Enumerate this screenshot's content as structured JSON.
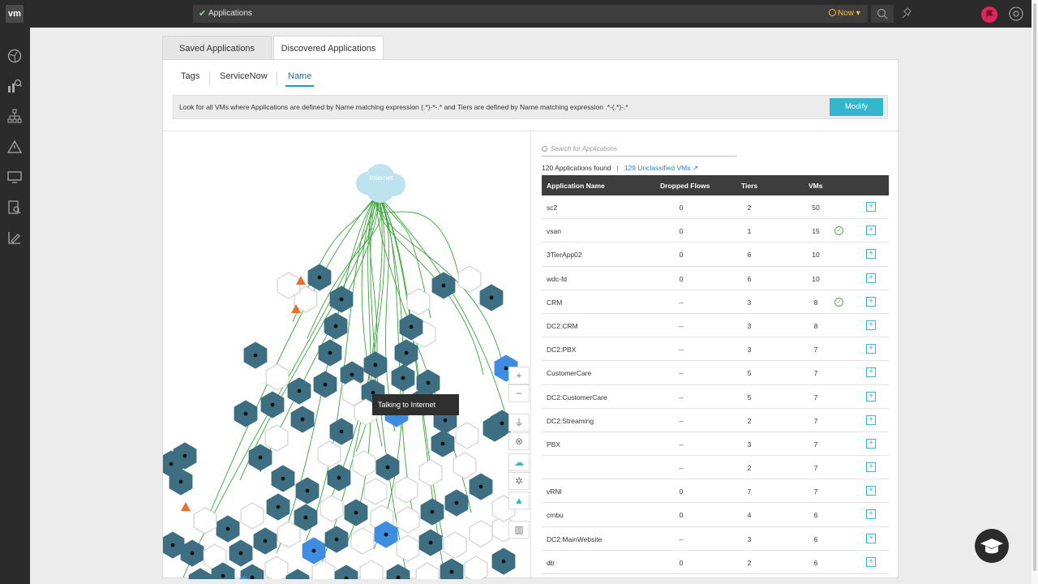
{
  "topbar": {
    "logo": "vm",
    "search_text": "Applications",
    "time_label": "Now"
  },
  "tabs": [
    {
      "label": "Saved Applications",
      "active": false
    },
    {
      "label": "Discovered Applications",
      "active": true
    }
  ],
  "subtabs": [
    "Tags",
    "ServiceNow",
    "Name"
  ],
  "query": {
    "text": "Look for all VMs where Applications are defined by Name matching expression (.*)-*-.* and Tiers are defined by Name matching expression .*-(.*)-.*",
    "button": "Modify"
  },
  "graph": {
    "internet_label": "Internet",
    "tooltip": "Talking to Internet"
  },
  "apps": {
    "search_placeholder": "Search for Applications",
    "found": "120 Applications found",
    "unclassified": "129 Unclassified VMs",
    "columns": [
      "Application Name",
      "Dropped Flows",
      "Tiers",
      "VMs"
    ],
    "rows": [
      {
        "name": "sc2",
        "dropped": "0",
        "tiers": "2",
        "vms": "50",
        "ok": false
      },
      {
        "name": "vsan",
        "dropped": "0",
        "tiers": "1",
        "vms": "15",
        "ok": true
      },
      {
        "name": "3TierApp02",
        "dropped": "0",
        "tiers": "6",
        "vms": "10",
        "ok": false
      },
      {
        "name": "wdc-fd",
        "dropped": "0",
        "tiers": "6",
        "vms": "10",
        "ok": false
      },
      {
        "name": "CRM",
        "dropped": "--",
        "tiers": "3",
        "vms": "8",
        "ok": true
      },
      {
        "name": "DC2:CRM",
        "dropped": "--",
        "tiers": "3",
        "vms": "8",
        "ok": false
      },
      {
        "name": "DC2:PBX",
        "dropped": "--",
        "tiers": "3",
        "vms": "7",
        "ok": false
      },
      {
        "name": "CustomerCare",
        "dropped": "--",
        "tiers": "5",
        "vms": "7",
        "ok": false
      },
      {
        "name": "DC2:CustomerCare",
        "dropped": "--",
        "tiers": "5",
        "vms": "7",
        "ok": false
      },
      {
        "name": "DC2:Streaming",
        "dropped": "--",
        "tiers": "2",
        "vms": "7",
        "ok": false
      },
      {
        "name": "PBX",
        "dropped": "--",
        "tiers": "3",
        "vms": "7",
        "ok": false
      },
      {
        "name": "",
        "dropped": "--",
        "tiers": "2",
        "vms": "7",
        "ok": false
      },
      {
        "name": "vRNI",
        "dropped": "0",
        "tiers": "7",
        "vms": "7",
        "ok": false
      },
      {
        "name": "cmbu",
        "dropped": "0",
        "tiers": "4",
        "vms": "6",
        "ok": false
      },
      {
        "name": "DC2:MainWebsite",
        "dropped": "--",
        "tiers": "3",
        "vms": "6",
        "ok": false
      },
      {
        "name": "db",
        "dropped": "0",
        "tiers": "2",
        "vms": "6",
        "ok": false
      }
    ]
  }
}
